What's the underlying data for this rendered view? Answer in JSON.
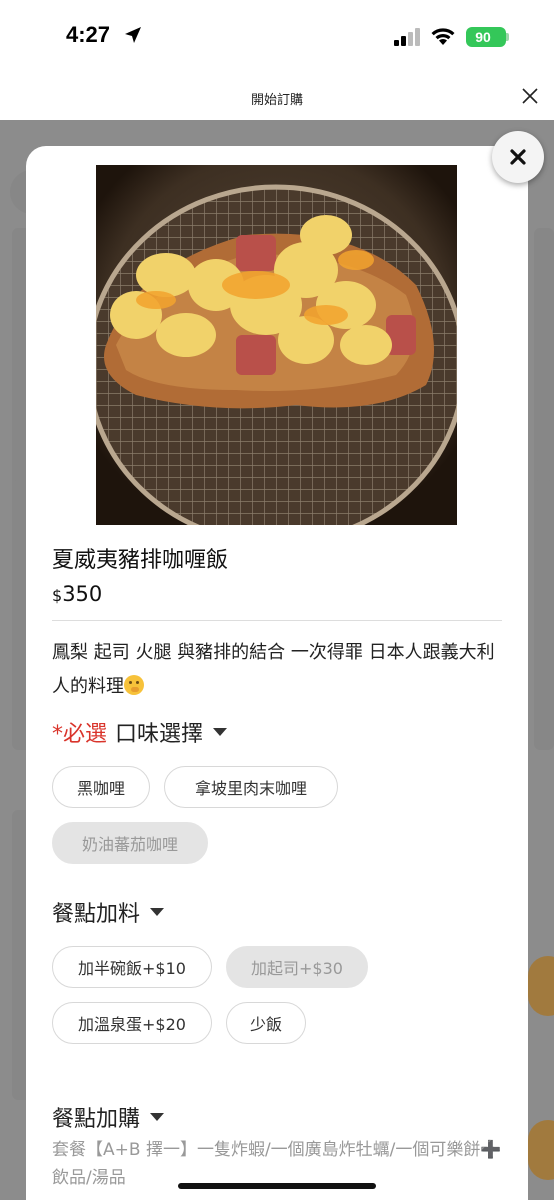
{
  "status_bar": {
    "time": "4:27",
    "battery": "90"
  },
  "header": {
    "title": "開始訂購"
  },
  "product": {
    "name": "夏威夷豬排咖喱飯",
    "currency": "$",
    "price": "350",
    "description": "鳳梨 起司 火腿 與豬排的結合 一次得罪 日本人跟義大利人的料理"
  },
  "flavor": {
    "required_label": "*必選",
    "title": "口味選擇",
    "options": [
      {
        "label": "黑咖哩",
        "available": true
      },
      {
        "label": "拿坡里肉末咖哩",
        "available": true
      },
      {
        "label": "奶油蕃茄咖哩",
        "available": false
      }
    ]
  },
  "addons": {
    "title": "餐點加料",
    "options": [
      {
        "label": "加半碗飯+$10",
        "available": true
      },
      {
        "label": "加起司+$30",
        "available": false
      },
      {
        "label": "加溫泉蛋+$20",
        "available": true
      },
      {
        "label": "少飯",
        "available": true
      }
    ]
  },
  "upsell": {
    "title": "餐點加購",
    "description": "套餐【A+B 擇一】一隻炸蝦/一個廣島炸牡蠣/一個可樂餅➕ 飲品/湯品"
  },
  "colors": {
    "required": "#d9342b",
    "battery": "#34c759",
    "disabled_chip": "#e4e4e4"
  },
  "icons": [
    "location-arrow-icon",
    "signal-icon",
    "wifi-icon",
    "battery-icon",
    "close-icon",
    "caret-down-icon",
    "shushing-face-emoji"
  ]
}
